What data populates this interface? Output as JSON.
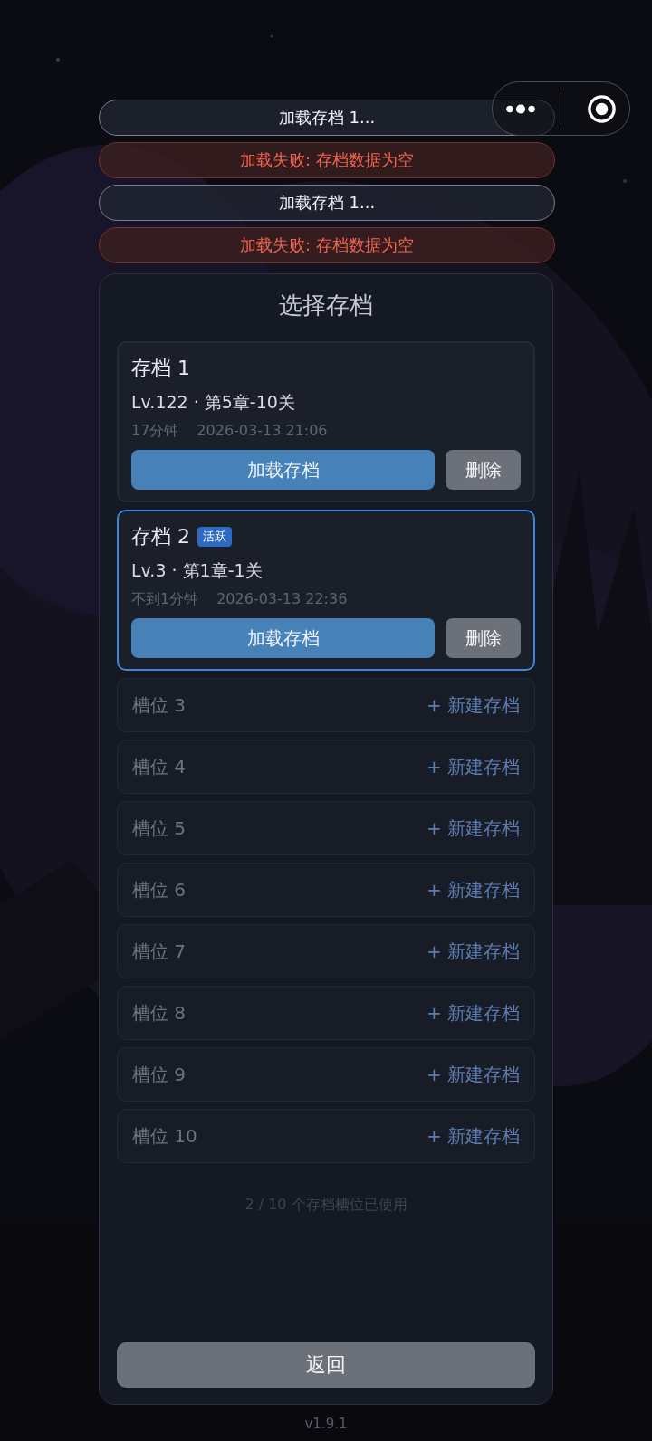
{
  "title": "选择存档",
  "slots": [
    {
      "kind": "save",
      "name": "存档 1",
      "selected": false,
      "level_stage": "Lv.122 · 第5章-10关",
      "playtime": "17分钟",
      "date": "2026-03-13 21:06",
      "load_button": "加载存档",
      "delete_button": "删除"
    },
    {
      "kind": "save",
      "name": "存档 2",
      "selected": true,
      "badge": "活跃",
      "level_stage": "Lv.3 · 第1章-1关",
      "playtime": "不到1分钟",
      "date": "2026-03-13 22:36",
      "load_button": "加载存档",
      "delete_button": "删除"
    },
    {
      "kind": "empty",
      "name": "槽位 3",
      "action": "+ 新建存档"
    },
    {
      "kind": "empty",
      "name": "槽位 4",
      "action": "+ 新建存档"
    },
    {
      "kind": "empty",
      "name": "槽位 5",
      "action": "+ 新建存档"
    },
    {
      "kind": "empty",
      "name": "槽位 6",
      "action": "+ 新建存档"
    },
    {
      "kind": "empty",
      "name": "槽位 7",
      "action": "+ 新建存档"
    },
    {
      "kind": "empty",
      "name": "槽位 8",
      "action": "+ 新建存档"
    },
    {
      "kind": "empty",
      "name": "槽位 9",
      "action": "+ 新建存档"
    },
    {
      "kind": "empty",
      "name": "槽位 10",
      "action": "+ 新建存档"
    }
  ],
  "usage": "2 / 10 个存档槽位已使用",
  "back_button": "返回",
  "version": "v1.9.1",
  "toasts": [
    {
      "kind": "info",
      "text": "加载存档 1..."
    },
    {
      "kind": "error",
      "text": "加载失败: 存档数据为空"
    },
    {
      "kind": "info",
      "text": "加载存档 1..."
    },
    {
      "kind": "error",
      "text": "加载失败: 存档数据为空"
    }
  ]
}
